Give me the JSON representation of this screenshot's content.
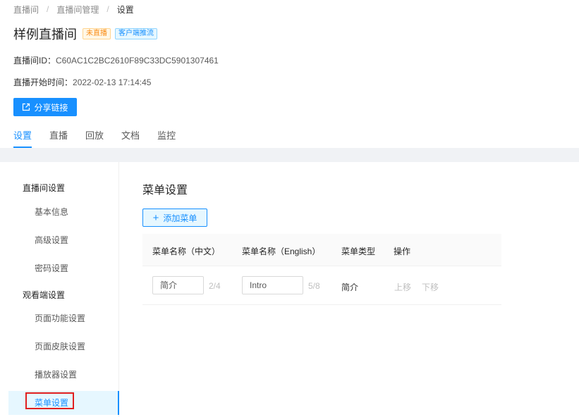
{
  "breadcrumb": {
    "item1": "直播间",
    "sep": "/",
    "item2": "直播间管理",
    "item3": "设置"
  },
  "header": {
    "title": "样例直播间",
    "status_tag": "未直播",
    "push_tag": "客户端推流"
  },
  "info": {
    "room_id_label": "直播间ID：",
    "room_id_value": "C60AC1C2BC2610F89C33DC5901307461",
    "start_label": "直播开始时间：",
    "start_value": "2022-02-13 17:14:45"
  },
  "share_button": {
    "label": "分享链接",
    "icon": "share-external-icon"
  },
  "tabs": [
    "设置",
    "直播",
    "回放",
    "文档",
    "监控"
  ],
  "sidebar": {
    "group1": "直播间设置",
    "group1_items": [
      "基本信息",
      "高级设置",
      "密码设置"
    ],
    "group2": "观看端设置",
    "group2_items": [
      "页面功能设置",
      "页面皮肤设置",
      "播放器设置",
      "菜单设置"
    ]
  },
  "main": {
    "section_title": "菜单设置",
    "add_button": "添加菜单",
    "columns": [
      "菜单名称（中文）",
      "菜单名称（English）",
      "菜单类型",
      "操作"
    ],
    "rows": [
      {
        "name_cn": "简介",
        "cn_count": "2/4",
        "name_en": "Intro",
        "en_count": "5/8",
        "type": "简介",
        "up": "上移",
        "down": "下移"
      }
    ]
  },
  "colors": {
    "primary": "#1890ff",
    "highlight_border": "#e02020",
    "tag_orange": "#fa8c16"
  }
}
